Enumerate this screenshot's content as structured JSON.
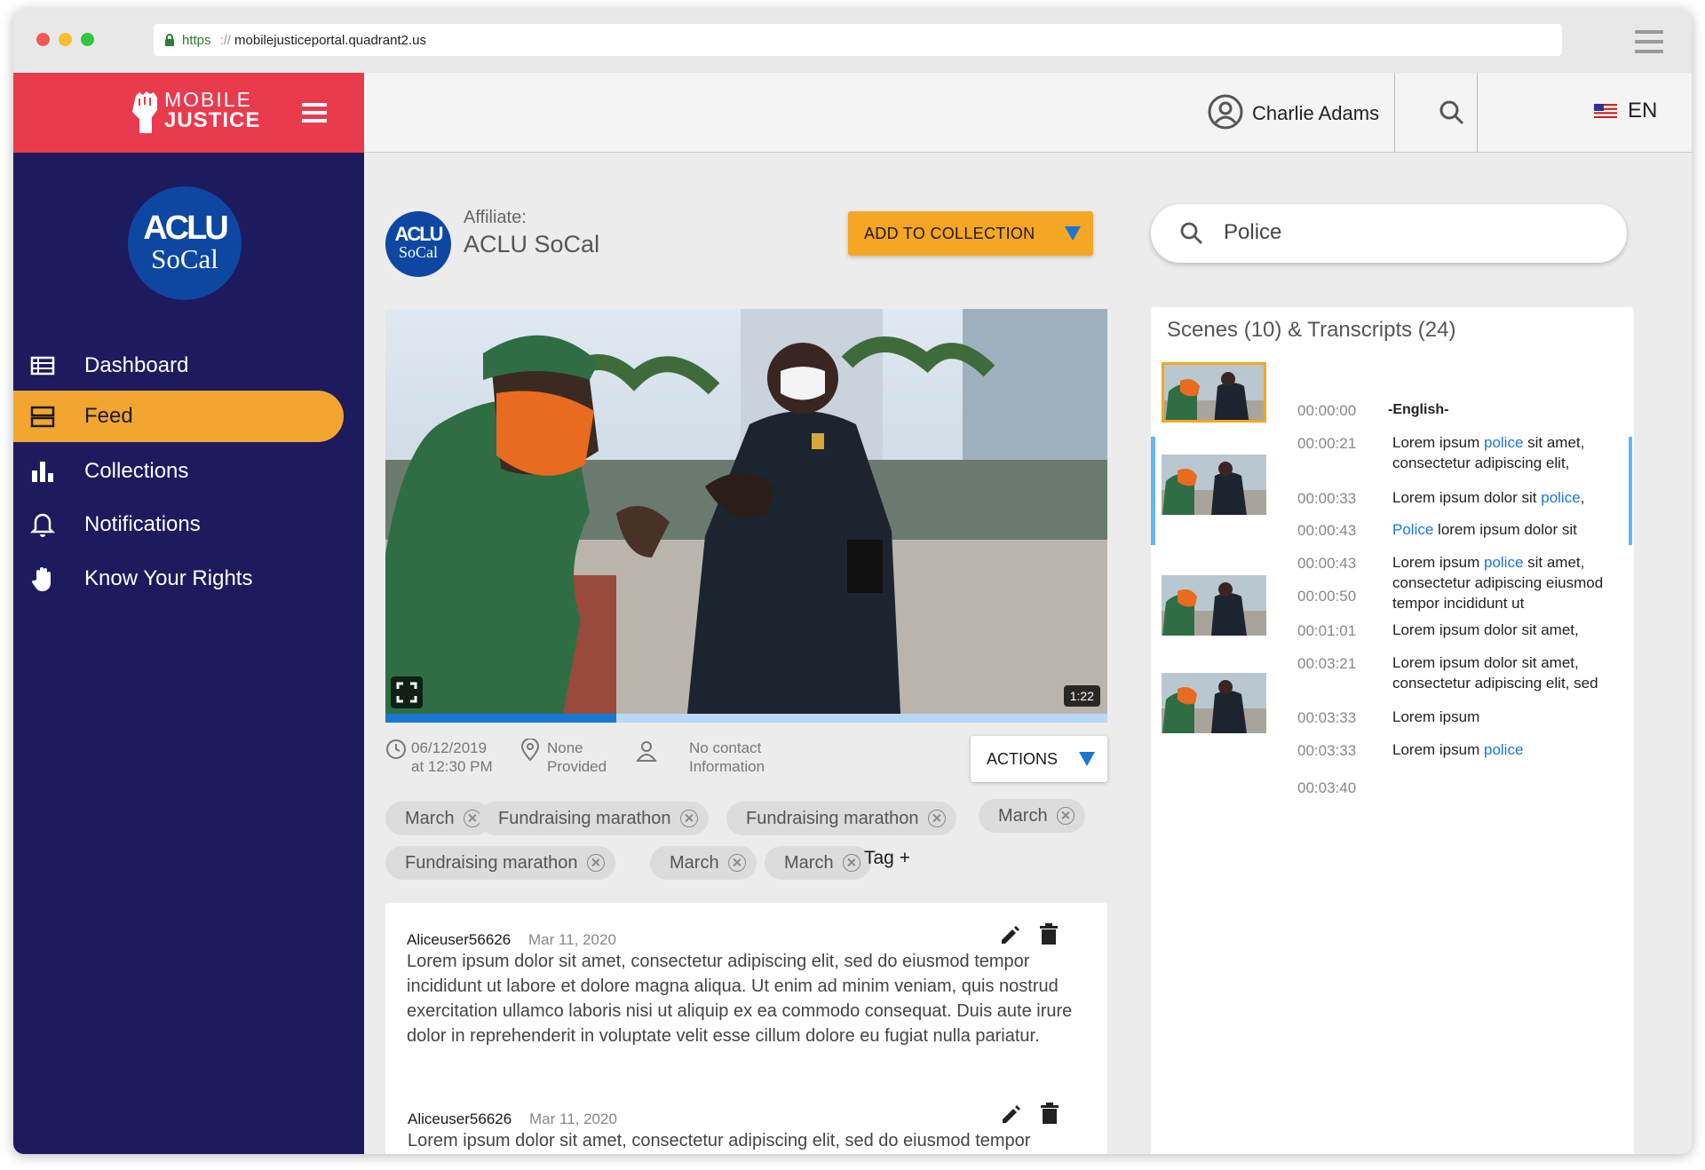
{
  "browser": {
    "scheme": "https",
    "separator": "://",
    "host": "mobilejusticeportal.quadrant2.us"
  },
  "brand": {
    "line1": "MOBILE",
    "line2": "JUSTICE",
    "color": "#ea3a4d"
  },
  "header": {
    "user_name": "Charlie Adams",
    "language": "EN"
  },
  "sidebar": {
    "logo": {
      "line1": "ACLU",
      "line2": "SoCal"
    },
    "items": [
      {
        "label": "Dashboard",
        "icon": "dashboard-icon",
        "active": false
      },
      {
        "label": "Feed",
        "icon": "feed-icon",
        "active": true
      },
      {
        "label": "Collections",
        "icon": "bar-chart-icon",
        "active": false
      },
      {
        "label": "Notifications",
        "icon": "bell-icon",
        "active": false
      },
      {
        "label": "Know Your Rights",
        "icon": "hand-icon",
        "active": false
      }
    ],
    "bg_color": "#1d1a5e",
    "active_color": "#f2a630"
  },
  "affiliate": {
    "label": "Affiliate:",
    "name": "ACLU SoCal",
    "logo_line1": "ACLU",
    "logo_line2": "SoCal"
  },
  "add_to_collection": "ADD TO COLLECTION",
  "video": {
    "duration": "1:22",
    "progress_fraction": 0.32
  },
  "meta": {
    "date_line1": "06/12/2019",
    "date_line2": "at 12:30 PM",
    "location_line1": "None",
    "location_line2": "Provided",
    "contact_line1": "No contact",
    "contact_line2": "Information"
  },
  "actions_label": "ACTIONS",
  "tags": [
    "March",
    "Fundraising marathon",
    "Fundraising marathon",
    "March",
    "Fundraising marathon",
    "March",
    "March"
  ],
  "tag_add": "Tag +",
  "comments": [
    {
      "user": "Aliceuser56626",
      "date": "Mar 11, 2020",
      "text": "Lorem ipsum dolor sit amet, consectetur adipiscing elit, sed do eiusmod tempor incididunt ut labore et dolore magna aliqua. Ut enim ad minim veniam, quis nostrud exercitation ullamco laboris nisi ut aliquip ex ea commodo consequat. Duis aute irure dolor in reprehenderit in voluptate velit esse cillum dolore eu fugiat nulla pariatur."
    },
    {
      "user": "Aliceuser56626",
      "date": "Mar 11, 2020",
      "text": "Lorem ipsum dolor sit amet, consectetur adipiscing elit, sed do eiusmod tempor"
    }
  ],
  "search": {
    "value": "Police"
  },
  "scenes": {
    "title": "Scenes (10) & Transcripts (24)",
    "transcript": [
      {
        "time": "00:00:00",
        "pre": "-English-",
        "hl": "",
        "post": ""
      },
      {
        "time": "00:00:21",
        "pre": "Lorem ipsum ",
        "hl": "police",
        "post": " sit amet, consectetur adipiscing elit,"
      },
      {
        "time": "00:00:33",
        "pre": "Lorem ipsum dolor sit ",
        "hl": "police",
        "post": ","
      },
      {
        "time": "00:00:43",
        "pre": "",
        "hl": "Police",
        "post": " lorem ipsum dolor sit"
      },
      {
        "time": "00:00:43",
        "pre": "Lorem ipsum ",
        "hl": "police",
        "post": " sit amet, consectetur adipiscing eiusmod tempor incididunt ut"
      },
      {
        "time": "00:00:50",
        "pre": "",
        "hl": "",
        "post": ""
      },
      {
        "time": "00:01:01",
        "pre": "Lorem ipsum dolor sit amet,",
        "hl": "",
        "post": ""
      },
      {
        "time": "00:03:21",
        "pre": "Lorem ipsum dolor sit amet, consectetur adipiscing elit, sed",
        "hl": "",
        "post": ""
      },
      {
        "time": "00:03:33",
        "pre": "Lorem ipsum",
        "hl": "",
        "post": ""
      },
      {
        "time": "00:03:33",
        "pre": "Lorem ipsum ",
        "hl": "police",
        "post": ""
      },
      {
        "time": "00:03:40",
        "pre": "",
        "hl": "",
        "post": ""
      }
    ],
    "highlight_color": "#1976d2"
  }
}
